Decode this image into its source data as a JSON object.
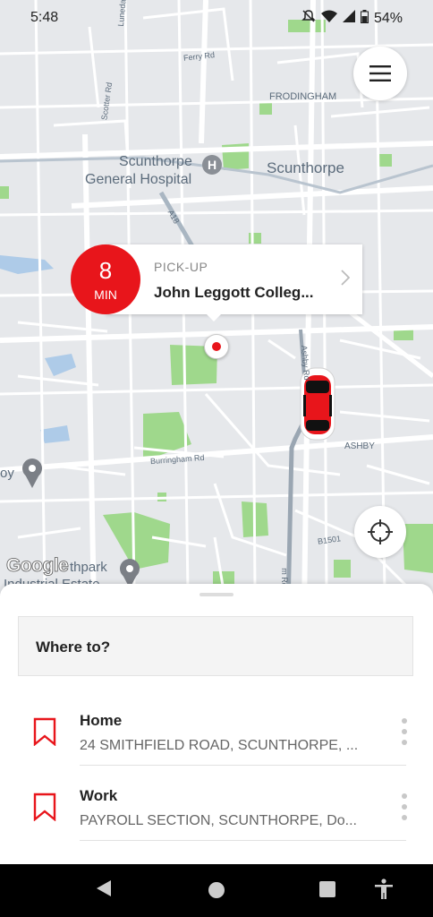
{
  "status_bar": {
    "time": "5:48",
    "battery": "54%",
    "icons": [
      "notifications-off-icon",
      "wifi-icon",
      "cellular-signal-icon",
      "battery-icon"
    ]
  },
  "map": {
    "labels": {
      "ferry_rd": "Ferry Rd",
      "scotter_rd": "Scotter Rd",
      "lunedale": "Lunedale",
      "frodingham": "FRODINGHAM",
      "hospital_line1": "Scunthorpe",
      "hospital_line2": "General Hospital",
      "hospital_icon": "H",
      "scunthorpe": "Scunthorpe",
      "a18": "A18",
      "ashby_rd": "Ashby Rd",
      "ashby": "ASHBY",
      "burringham_rd": "Burringham Rd",
      "b1501": "B1501",
      "oy": "oy",
      "thpark_line1": "thpark",
      "thpark_line2": "Industrial Estate",
      "m_rd": "m Rd"
    },
    "attribution": "Google"
  },
  "pickup": {
    "eta_value": "8",
    "eta_unit": "MIN",
    "label": "PICK-UP",
    "name": "John Leggott Colleg..."
  },
  "sheet": {
    "search_placeholder": "Where to?",
    "saved_places": [
      {
        "title": "Home",
        "address": "24 SMITHFIELD ROAD, SCUNTHORPE, ..."
      },
      {
        "title": "Work",
        "address": "PAYROLL SECTION, SCUNTHORPE, Do..."
      }
    ]
  },
  "colors": {
    "accent": "#e8151b",
    "map_park": "#9fd88c",
    "map_road": "#ffffff",
    "map_main_road": "#a9b6c2"
  }
}
